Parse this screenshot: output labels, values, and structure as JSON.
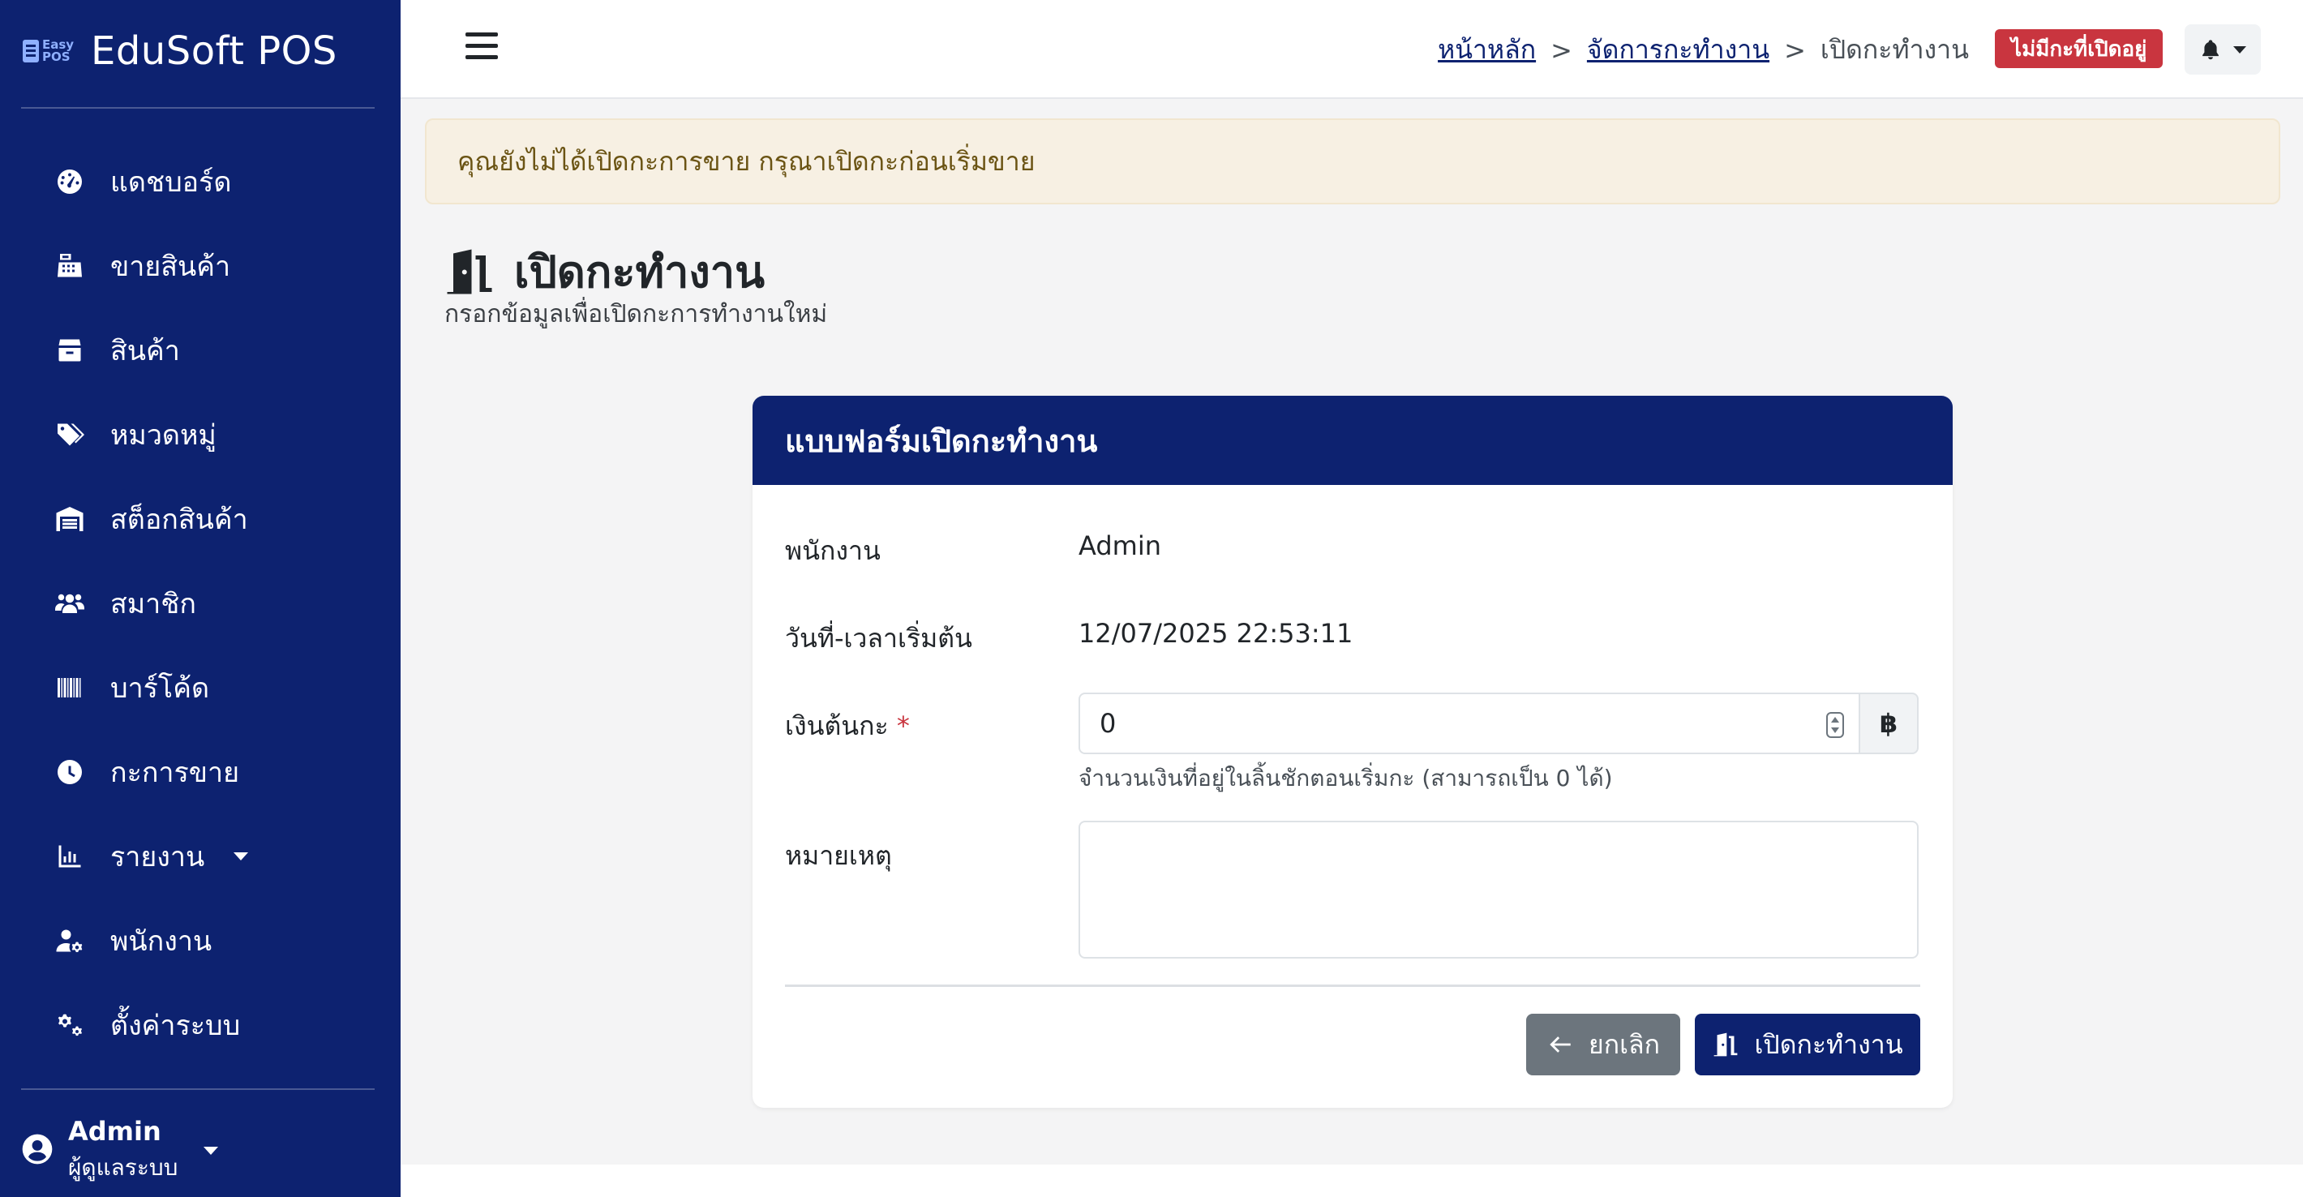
{
  "brand": {
    "logo_text_top": "Easy",
    "logo_text_bottom": "POS",
    "name": "EduSoft POS"
  },
  "sidebar": {
    "items": [
      {
        "label": "แดชบอร์ด",
        "icon": "dashboard-gauge-icon"
      },
      {
        "label": "ขายสินค้า",
        "icon": "cash-register-icon"
      },
      {
        "label": "สินค้า",
        "icon": "box-icon"
      },
      {
        "label": "หมวดหมู่",
        "icon": "tags-icon"
      },
      {
        "label": "สต็อกสินค้า",
        "icon": "warehouse-icon"
      },
      {
        "label": "สมาชิก",
        "icon": "users-icon"
      },
      {
        "label": "บาร์โค้ด",
        "icon": "barcode-icon"
      },
      {
        "label": "กะการขาย",
        "icon": "clock-icon"
      },
      {
        "label": "รายงาน",
        "icon": "chart-icon",
        "has_dropdown": true
      },
      {
        "label": "พนักงาน",
        "icon": "user-gear-icon"
      },
      {
        "label": "ตั้งค่าระบบ",
        "icon": "gears-icon"
      }
    ],
    "user": {
      "name": "Admin",
      "role": "ผู้ดูแลระบบ"
    }
  },
  "topbar": {
    "breadcrumb": {
      "home": "หน้าหลัก",
      "separator": ">",
      "manage_shift": "จัดการกะทำงาน",
      "current": "เปิดกะทำงาน"
    },
    "status_badge": "ไม่มีกะที่เปิดอยู่"
  },
  "alert": {
    "message": "คุณยังไม่ได้เปิดกะการขาย กรุณาเปิดกะก่อนเริ่มขาย"
  },
  "page": {
    "title": "เปิดกะทำงาน",
    "subtitle": "กรอกข้อมูลเพื่อเปิดกะการทำงานใหม่"
  },
  "form": {
    "header": "แบบฟอร์มเปิดกะทำงาน",
    "employee_label": "พนักงาน",
    "employee_value": "Admin",
    "start_label": "วันที่-เวลาเริ่มต้น",
    "start_value": "12/07/2025 22:53:11",
    "cash_label": "เงินต้นกะ",
    "required_mark": "*",
    "cash_value": "0",
    "currency_symbol": "฿",
    "cash_help": "จำนวนเงินที่อยู่ในลิ้นชักตอนเริ่มกะ (สามารถเป็น 0 ได้)",
    "note_label": "หมายเหตุ",
    "note_value": "",
    "cancel_label": "ยกเลิก",
    "submit_label": "เปิดกะทำงาน"
  },
  "colors": {
    "primary_navy": "#0d2270",
    "danger_badge": "#c9353f",
    "alert_bg": "#f7f0e3",
    "secondary_btn": "#6c757d"
  }
}
